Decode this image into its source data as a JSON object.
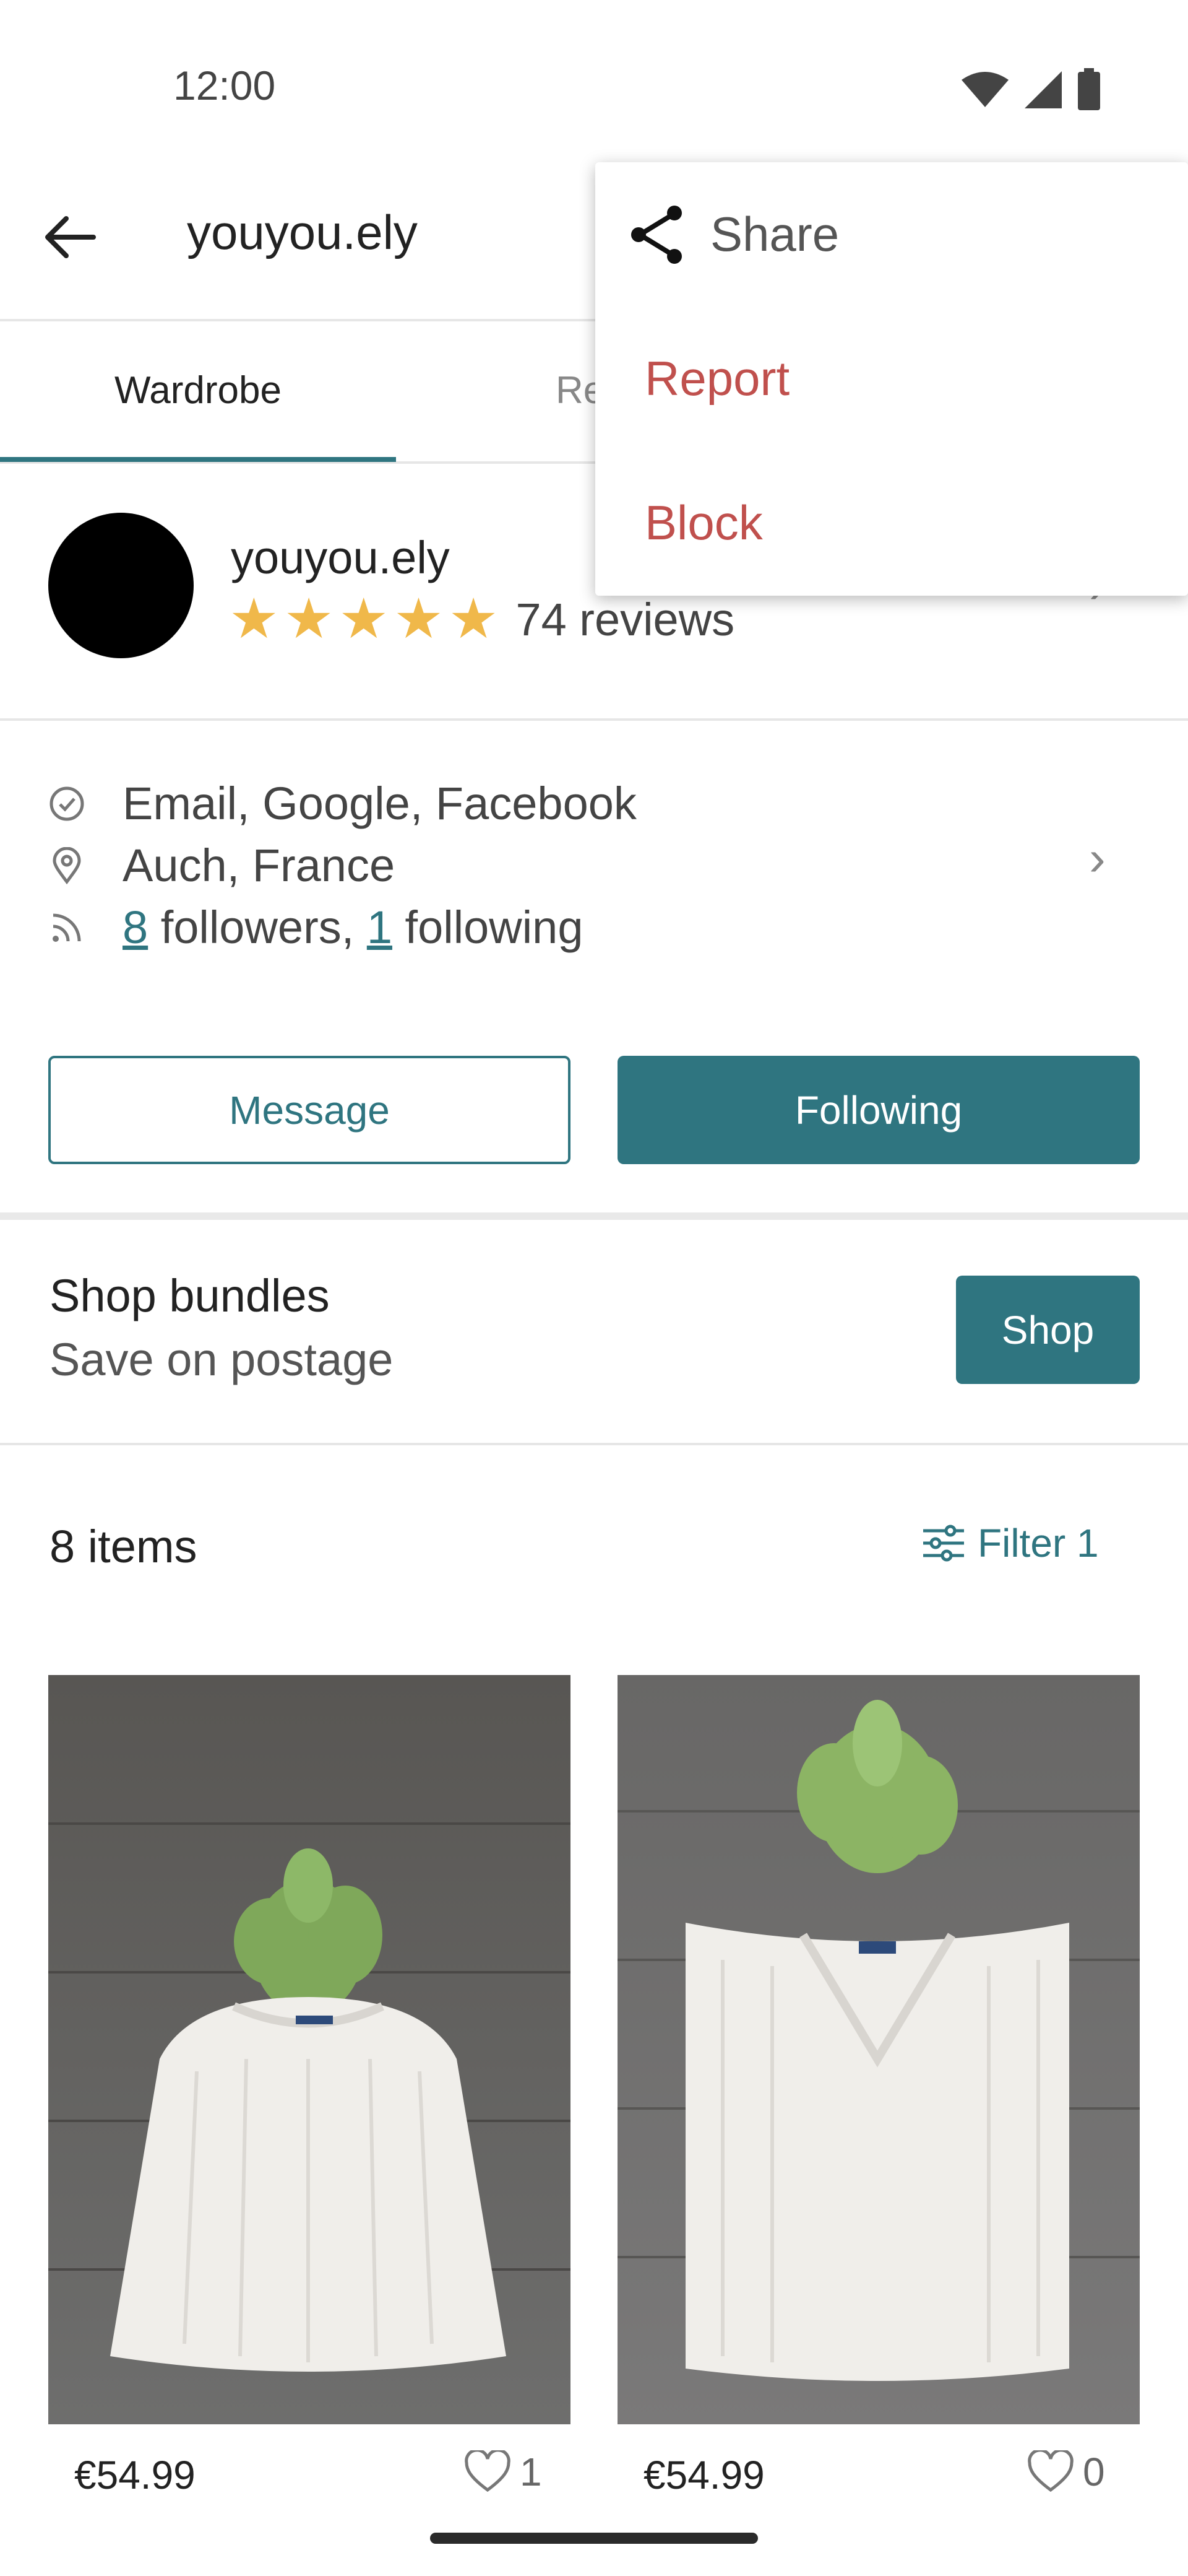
{
  "status_bar": {
    "time": "12:00"
  },
  "header": {
    "title": "youyou.ely"
  },
  "tabs": [
    {
      "label": "Wardrobe"
    },
    {
      "label": "Revi"
    }
  ],
  "profile": {
    "name": "youyou.ely",
    "stars": 5,
    "reviews_label": "74 reviews"
  },
  "info": {
    "verified": "Email, Google, Facebook",
    "location": "Auch, France",
    "followers_count": "8",
    "followers_text": " followers, ",
    "following_count": "1",
    "following_text": " following"
  },
  "buttons": {
    "message": "Message",
    "following": "Following"
  },
  "bundles": {
    "title": "Shop bundles",
    "subtitle": "Save on postage",
    "shop": "Shop"
  },
  "items_section": {
    "count_label": "8 items",
    "filter_label": "Filter 1"
  },
  "items": [
    {
      "price": "€54.99",
      "likes": "1"
    },
    {
      "price": "€54.99",
      "likes": "0"
    }
  ],
  "menu": {
    "share": "Share",
    "report": "Report",
    "block": "Block"
  },
  "colors": {
    "accent": "#2f7580",
    "star": "#f0b84a",
    "danger": "#c0504d"
  }
}
